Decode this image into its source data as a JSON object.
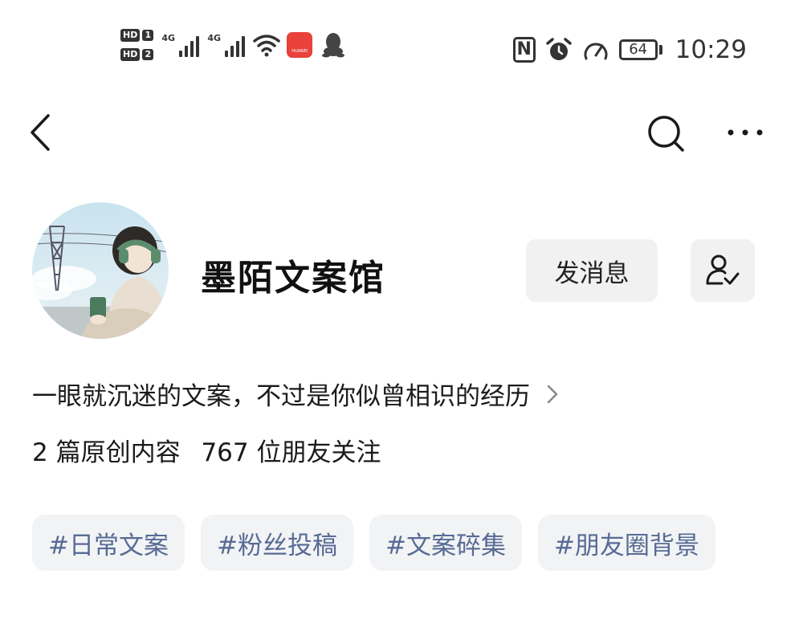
{
  "status_bar": {
    "hd1_label": "HD",
    "hd1_num": "1",
    "hd2_label": "HD",
    "hd2_num": "2",
    "signal1_label": "4G",
    "signal2_label": "4G",
    "huawei_label": "HUAWEI",
    "nfc_label": "N",
    "battery_level": "64",
    "time": "10:29"
  },
  "profile": {
    "name": "墨陌文案馆",
    "bio": "一眼就沉迷的文案，不过是你似曾相识的经历",
    "original_count": "2 篇原创内容",
    "followers": "767 位朋友关注"
  },
  "actions": {
    "message_label": "发消息"
  },
  "tags": [
    "#日常文案",
    "#粉丝投稿",
    "#文案碎集",
    "#朋友圈背景"
  ],
  "colors": {
    "tag_text": "#576b95",
    "tag_bg": "#f2f3f5",
    "button_bg": "#f1f1f1"
  },
  "icons": [
    "back-arrow-icon",
    "search-icon",
    "more-icon",
    "follow-icon",
    "chevron-right-icon",
    "wifi-icon",
    "alarm-icon",
    "speed-icon",
    "qq-icon",
    "huawei-app-icon"
  ]
}
